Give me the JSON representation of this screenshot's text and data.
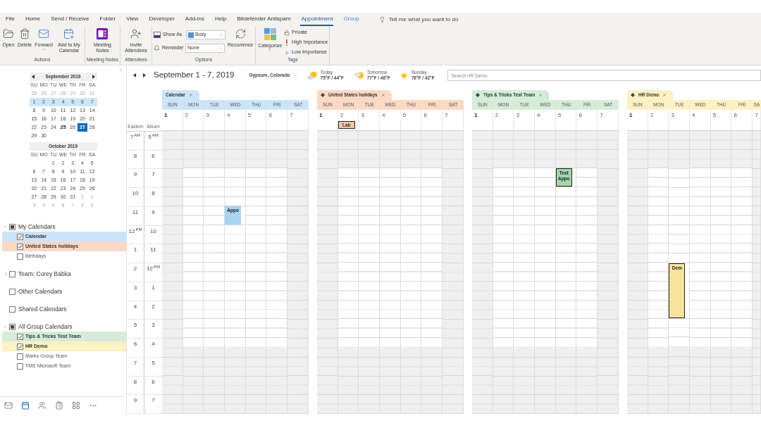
{
  "menu": {
    "tabs": [
      {
        "label": "File",
        "selected": false,
        "contextual": false
      },
      {
        "label": "Home",
        "selected": false,
        "contextual": false
      },
      {
        "label": "Send / Receive",
        "selected": false,
        "contextual": false
      },
      {
        "label": "Folder",
        "selected": false,
        "contextual": false
      },
      {
        "label": "View",
        "selected": false,
        "contextual": false
      },
      {
        "label": "Developer",
        "selected": false,
        "contextual": false
      },
      {
        "label": "Add-ins",
        "selected": false,
        "contextual": false
      },
      {
        "label": "Help",
        "selected": false,
        "contextual": false
      },
      {
        "label": "Bitdefender Antispam",
        "selected": false,
        "contextual": false
      },
      {
        "label": "Appointment",
        "selected": true,
        "contextual": true
      },
      {
        "label": "Group",
        "selected": false,
        "contextual": true
      }
    ],
    "tell_me": {
      "placeholder": "Tell me what you want to do"
    }
  },
  "ribbon": {
    "groups": [
      {
        "label": "Actions",
        "controls": [
          {
            "kind": "large",
            "label": "Open",
            "dropdown": false
          },
          {
            "kind": "large",
            "label": "Delete",
            "dropdown": false
          },
          {
            "kind": "large",
            "label": "Forward",
            "dropdown": true
          },
          {
            "kind": "large",
            "label": "Add to My Calendar",
            "dropdown": false
          }
        ]
      },
      {
        "label": "Meeting Notes",
        "controls": [
          {
            "kind": "large",
            "label": "Meeting Notes",
            "dropdown": false
          }
        ]
      },
      {
        "label": "Attendees",
        "controls": [
          {
            "kind": "large",
            "label": "Invite Attendees",
            "dropdown": false
          }
        ]
      },
      {
        "label": "Options",
        "controls": [
          {
            "kind": "field",
            "label": "Show As",
            "value": "Busy"
          },
          {
            "kind": "field",
            "label": "Reminder",
            "value": "None"
          },
          {
            "kind": "large",
            "label": "Recurrence",
            "dropdown": false
          }
        ]
      },
      {
        "label": "Tags",
        "controls": [
          {
            "kind": "large",
            "label": "Categorize",
            "dropdown": true
          },
          {
            "kind": "small",
            "label": "Private"
          },
          {
            "kind": "small",
            "label": "High Importance"
          },
          {
            "kind": "small",
            "label": "Low Importance"
          }
        ]
      }
    ]
  },
  "sidebar": {
    "months": [
      {
        "title": "September 2019",
        "nav_arrows": true,
        "weekdays": [
          "SU",
          "MO",
          "TU",
          "WE",
          "TH",
          "FR",
          "SA"
        ],
        "weeks": [
          {
            "selected": false,
            "days": [
              {
                "text": "25",
                "kind": "muted"
              },
              {
                "text": "26",
                "kind": "muted"
              },
              {
                "text": "27",
                "kind": "muted"
              },
              {
                "text": "28",
                "kind": "muted"
              },
              {
                "text": "29",
                "kind": "muted"
              },
              {
                "text": "30",
                "kind": "muted"
              },
              {
                "text": "31",
                "kind": "muted"
              }
            ]
          },
          {
            "selected": true,
            "days": [
              {
                "text": "1",
                "kind": "normal"
              },
              {
                "text": "2",
                "kind": "normal"
              },
              {
                "text": "3",
                "kind": "normal"
              },
              {
                "text": "4",
                "kind": "normal"
              },
              {
                "text": "5",
                "kind": "normal"
              },
              {
                "text": "6",
                "kind": "normal"
              },
              {
                "text": "7",
                "kind": "normal"
              }
            ]
          },
          {
            "selected": false,
            "days": [
              {
                "text": "8",
                "kind": "normal"
              },
              {
                "text": "9",
                "kind": "normal"
              },
              {
                "text": "10",
                "kind": "normal"
              },
              {
                "text": "11",
                "kind": "normal"
              },
              {
                "text": "12",
                "kind": "normal"
              },
              {
                "text": "13",
                "kind": "normal"
              },
              {
                "text": "14",
                "kind": "normal"
              }
            ]
          },
          {
            "selected": false,
            "days": [
              {
                "text": "15",
                "kind": "normal"
              },
              {
                "text": "16",
                "kind": "normal"
              },
              {
                "text": "17",
                "kind": "normal"
              },
              {
                "text": "18",
                "kind": "normal"
              },
              {
                "text": "19",
                "kind": "normal"
              },
              {
                "text": "20",
                "kind": "normal"
              },
              {
                "text": "21",
                "kind": "normal"
              }
            ]
          },
          {
            "selected": false,
            "days": [
              {
                "text": "22",
                "kind": "normal"
              },
              {
                "text": "23",
                "kind": "normal"
              },
              {
                "text": "24",
                "kind": "normal"
              },
              {
                "text": "25",
                "kind": "busy"
              },
              {
                "text": "26",
                "kind": "normal"
              },
              {
                "text": "27",
                "kind": "today"
              },
              {
                "text": "28",
                "kind": "normal"
              }
            ]
          },
          {
            "selected": false,
            "days": [
              {
                "text": "29",
                "kind": "normal"
              },
              {
                "text": "30",
                "kind": "normal"
              }
            ]
          }
        ]
      },
      {
        "title": "October 2019",
        "nav_arrows": false,
        "weekdays": [
          "SU",
          "MO",
          "TU",
          "WE",
          "TH",
          "FR",
          "SA"
        ],
        "weeks": [
          {
            "selected": false,
            "days": [
              {
                "text": "1",
                "kind": "normal"
              },
              {
                "text": "2",
                "kind": "normal"
              },
              {
                "text": "3",
                "kind": "normal"
              },
              {
                "text": "4",
                "kind": "normal"
              },
              {
                "text": "5",
                "kind": "normal"
              }
            ]
          },
          {
            "selected": false,
            "days": [
              {
                "text": "6",
                "kind": "normal"
              },
              {
                "text": "7",
                "kind": "normal"
              },
              {
                "text": "8",
                "kind": "normal"
              },
              {
                "text": "9",
                "kind": "normal"
              },
              {
                "text": "10",
                "kind": "normal"
              },
              {
                "text": "11",
                "kind": "normal"
              },
              {
                "text": "12",
                "kind": "normal"
              }
            ]
          },
          {
            "selected": false,
            "days": [
              {
                "text": "13",
                "kind": "normal"
              },
              {
                "text": "14",
                "kind": "normal"
              },
              {
                "text": "15",
                "kind": "normal"
              },
              {
                "text": "16",
                "kind": "normal"
              },
              {
                "text": "17",
                "kind": "normal"
              },
              {
                "text": "18",
                "kind": "normal"
              },
              {
                "text": "19",
                "kind": "normal"
              }
            ]
          },
          {
            "selected": false,
            "days": [
              {
                "text": "20",
                "kind": "normal"
              },
              {
                "text": "21",
                "kind": "normal"
              },
              {
                "text": "22",
                "kind": "normal"
              },
              {
                "text": "23",
                "kind": "normal"
              },
              {
                "text": "24",
                "kind": "normal"
              },
              {
                "text": "25",
                "kind": "normal"
              },
              {
                "text": "26",
                "kind": "normal"
              }
            ]
          },
          {
            "selected": false,
            "days": [
              {
                "text": "27",
                "kind": "normal"
              },
              {
                "text": "28",
                "kind": "normal"
              },
              {
                "text": "29",
                "kind": "normal"
              },
              {
                "text": "30",
                "kind": "normal"
              },
              {
                "text": "31",
                "kind": "normal"
              },
              {
                "text": "1",
                "kind": "muted"
              },
              {
                "text": "2",
                "kind": "muted"
              }
            ]
          },
          {
            "selected": false,
            "days": [
              {
                "text": "3",
                "kind": "muted"
              },
              {
                "text": "4",
                "kind": "muted"
              },
              {
                "text": "5",
                "kind": "muted"
              },
              {
                "text": "6",
                "kind": "muted"
              },
              {
                "text": "7",
                "kind": "muted"
              },
              {
                "text": "8",
                "kind": "muted"
              },
              {
                "text": "9",
                "kind": "muted"
              }
            ]
          }
        ]
      }
    ],
    "calendar_groups": [
      {
        "label": "My Calendars",
        "kind": "expanded",
        "partial": true,
        "children": [
          {
            "label": "Calendar",
            "checked": true,
            "color": "#cce4f7"
          },
          {
            "label": "United States holidays",
            "checked": true,
            "color": "#fad9c5"
          },
          {
            "label": "Birthdays",
            "checked": false
          }
        ]
      },
      {
        "label": "Team: Corey Babka",
        "kind": "collapsed",
        "partial": false
      },
      {
        "label": "Other Calendars",
        "kind": "plain",
        "partial": false
      },
      {
        "label": "Shared Calendars",
        "kind": "plain",
        "partial": false
      },
      {
        "label": "All Group Calendars",
        "kind": "expanded",
        "partial": true,
        "children": [
          {
            "label": "Tips & Tricks Test Team",
            "checked": true,
            "color": "#d5ecd9"
          },
          {
            "label": "HR Demo",
            "checked": true,
            "color": "#fcf1c2"
          },
          {
            "label": "Marks Group Team",
            "checked": false
          },
          {
            "label": "TMS Microsoft Team",
            "checked": false
          }
        ]
      }
    ],
    "nav": [
      {
        "selected": false
      },
      {
        "selected": true
      },
      {
        "selected": false
      },
      {
        "selected": false
      },
      {
        "selected": false
      },
      {
        "selected": false
      }
    ]
  },
  "header": {
    "date_range": "September 1 - 7, 2019",
    "location": "Gypsum, Colorado",
    "weather": [
      {
        "day": "Today",
        "temps": "75°F / 44°F",
        "kind": "mostly_sunny"
      },
      {
        "day": "Tomorrow",
        "temps": "77°F / 46°F",
        "kind": "partly_cloudy"
      },
      {
        "day": "Sunday",
        "temps": "76°F / 42°F",
        "kind": "sunny"
      }
    ],
    "search": {
      "placeholder": "Search HR Demo"
    }
  },
  "time_scale": {
    "zones": [
      "Eastern",
      "Mount"
    ],
    "rows": [
      {
        "labels": [
          "7$^{AM}$",
          "5$^{AM}$"
        ],
        "kind": "off"
      },
      {
        "labels": [
          "8",
          "6"
        ],
        "kind": "off"
      },
      {
        "labels": [
          "9",
          "7"
        ],
        "kind": "work"
      },
      {
        "labels": [
          "10",
          "8"
        ],
        "kind": "work"
      },
      {
        "labels": [
          "11",
          "9"
        ],
        "kind": "work"
      },
      {
        "labels": [
          "12$^{PM}$",
          "10"
        ],
        "kind": "work"
      },
      {
        "labels": [
          "1",
          "11"
        ],
        "kind": "work"
      },
      {
        "labels": [
          "2",
          "12$^{PM}$"
        ],
        "kind": "work"
      },
      {
        "labels": [
          "3",
          "1"
        ],
        "kind": "work"
      },
      {
        "labels": [
          "4",
          "2"
        ],
        "kind": "work"
      },
      {
        "labels": [
          "5",
          "3"
        ],
        "kind": "work"
      },
      {
        "labels": [
          "6",
          "4"
        ],
        "kind": "half"
      },
      {
        "labels": [
          "7",
          "5"
        ],
        "kind": "off"
      },
      {
        "labels": [
          "8",
          "6"
        ],
        "kind": "off"
      },
      {
        "labels": [
          "9",
          "7"
        ],
        "kind": "off"
      }
    ]
  },
  "calendars": [
    {
      "title": "Calendar",
      "color": "#cce4f7",
      "overlay": false,
      "days": [
        {
          "label": "SUN",
          "date": "1",
          "bold": true,
          "workday": false
        },
        {
          "label": "MON",
          "date": "2",
          "bold": false,
          "workday": true
        },
        {
          "label": "TUE",
          "date": "3",
          "bold": false,
          "workday": true
        },
        {
          "label": "WED",
          "date": "4",
          "bold": false,
          "workday": true,
          "hours": [
            {
              "busy": false
            },
            {
              "busy": false
            },
            {
              "busy": false
            },
            {
              "busy": false
            },
            {
              "busy": true
            },
            {
              "busy": false
            },
            {
              "busy": false
            },
            {
              "busy": false
            },
            {
              "busy": false
            },
            {
              "busy": false
            },
            {
              "busy": false
            },
            {
              "busy": false
            },
            {
              "busy": false
            },
            {
              "busy": false
            },
            {
              "busy": false
            }
          ],
          "events": [
            {
              "title": "Appo",
              "kind": "timed",
              "color": "#a9d4f2",
              "outlined": false
            }
          ]
        },
        {
          "label": "THU",
          "date": "5",
          "bold": false,
          "workday": true
        },
        {
          "label": "FRI",
          "date": "6",
          "bold": false,
          "workday": true
        },
        {
          "label": "SAT",
          "date": "7",
          "bold": false,
          "workday": false
        }
      ]
    },
    {
      "title": "United States holidays",
      "color": "#fad9c5",
      "overlay": true,
      "days": [
        {
          "label": "SUN",
          "date": "1",
          "bold": true,
          "workday": false
        },
        {
          "label": "MON",
          "date": "2",
          "bold": false,
          "workday": true,
          "events": [
            {
              "title": "Lab",
              "kind": "all_day",
              "color": "#f6c7a2",
              "outlined": true
            }
          ]
        },
        {
          "label": "TUE",
          "date": "3",
          "bold": false,
          "workday": true
        },
        {
          "label": "WED",
          "date": "4",
          "bold": false,
          "workday": true
        },
        {
          "label": "THU",
          "date": "5",
          "bold": false,
          "workday": true
        },
        {
          "label": "FRI",
          "date": "6",
          "bold": false,
          "workday": true
        },
        {
          "label": "SAT",
          "date": "7",
          "bold": false,
          "workday": false
        }
      ]
    },
    {
      "title": "Tips & Tricks Test Team",
      "color": "#d5ecd9",
      "overlay": true,
      "days": [
        {
          "label": "SUN",
          "date": "1",
          "bold": true,
          "workday": false
        },
        {
          "label": "MON",
          "date": "2",
          "bold": false,
          "workday": true
        },
        {
          "label": "TUE",
          "date": "3",
          "bold": false,
          "workday": true
        },
        {
          "label": "WED",
          "date": "4",
          "bold": false,
          "workday": true
        },
        {
          "label": "THU",
          "date": "5",
          "bold": false,
          "workday": true,
          "hours": [
            {
              "busy": false
            },
            {
              "busy": false
            },
            {
              "busy": true
            },
            {
              "busy": false
            },
            {
              "busy": false
            },
            {
              "busy": false
            },
            {
              "busy": false
            },
            {
              "busy": false
            },
            {
              "busy": false
            },
            {
              "busy": false
            },
            {
              "busy": false
            },
            {
              "busy": false
            },
            {
              "busy": false
            },
            {
              "busy": false
            },
            {
              "busy": false
            }
          ],
          "events": [
            {
              "title": "Test Appo",
              "kind": "timed",
              "color": "#a3d8ad",
              "outlined": true
            }
          ]
        },
        {
          "label": "FRI",
          "date": "6",
          "bold": false,
          "workday": true
        },
        {
          "label": "SAT",
          "date": "7",
          "bold": false,
          "workday": false
        }
      ]
    },
    {
      "title": "HR Demo",
      "color": "#fcf1c2",
      "overlay": true,
      "days": [
        {
          "label": "SUN",
          "date": "1",
          "bold": true,
          "workday": false
        },
        {
          "label": "MON",
          "date": "2",
          "bold": false,
          "workday": true
        },
        {
          "label": "TUE",
          "date": "3",
          "bold": false,
          "workday": true,
          "hours": [
            {
              "busy": false
            },
            {
              "busy": false
            },
            {
              "busy": false
            },
            {
              "busy": false
            },
            {
              "busy": false
            },
            {
              "busy": false
            },
            {
              "busy": false
            },
            {
              "busy": true
            },
            {
              "busy": true
            },
            {
              "busy": true
            },
            {
              "busy": false
            },
            {
              "busy": false
            },
            {
              "busy": false
            },
            {
              "busy": false
            },
            {
              "busy": false
            }
          ],
          "events": [
            {
              "title": "Dem",
              "kind": "timed",
              "color": "#f8e39c",
              "outlined": true
            }
          ]
        },
        {
          "label": "WED",
          "date": "4",
          "bold": false,
          "workday": true
        },
        {
          "label": "THU",
          "date": "5",
          "bold": false,
          "workday": true
        },
        {
          "label": "FRI",
          "date": "6",
          "bold": false,
          "workday": true
        },
        {
          "label": "SA",
          "date": "7",
          "bold": false,
          "workday": false
        }
      ]
    }
  ]
}
